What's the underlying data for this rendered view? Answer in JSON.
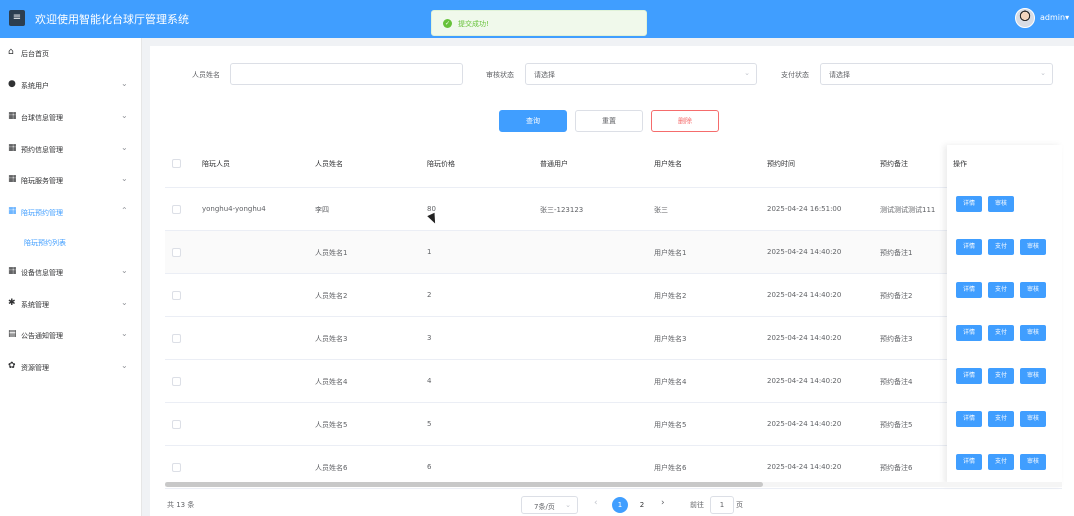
{
  "header": {
    "menu_toggle_glyph": "≡",
    "title": "欢迎使用智能化台球厅管理系统",
    "user_name": "admin▾"
  },
  "toast": {
    "icon_glyph": "✓",
    "message": "提交成功!"
  },
  "sidebar": {
    "items": [
      {
        "label": "后台首页",
        "icon": "home-icon",
        "glyph": "⌂",
        "arrow": ""
      },
      {
        "label": "系统用户",
        "icon": "user-icon",
        "glyph": "●",
        "arrow": "⌄"
      },
      {
        "label": "台球信息管理",
        "icon": "grid-icon",
        "glyph": "▦",
        "arrow": "⌄"
      },
      {
        "label": "预约信息管理",
        "icon": "grid-icon",
        "glyph": "▦",
        "arrow": "⌄"
      },
      {
        "label": "陪玩服务管理",
        "icon": "grid-icon",
        "glyph": "▦",
        "arrow": "⌄"
      },
      {
        "label": "陪玩预约管理",
        "icon": "grid-icon",
        "glyph": "▦",
        "arrow": "⌃",
        "active": true
      },
      {
        "label": "设备信息管理",
        "icon": "grid-icon",
        "glyph": "▦",
        "arrow": "⌄"
      },
      {
        "label": "系统管理",
        "icon": "gear-icon",
        "glyph": "✱",
        "arrow": "⌄"
      },
      {
        "label": "公告通知管理",
        "icon": "document-icon",
        "glyph": "▤",
        "arrow": "⌄"
      },
      {
        "label": "资源管理",
        "icon": "settings-icon",
        "glyph": "✿",
        "arrow": "⌄"
      }
    ],
    "sub_item": "陪玩预约列表"
  },
  "search": {
    "name_label": "人员姓名",
    "name_value": "",
    "review_label": "审核状态",
    "review_placeholder": "请选择",
    "pay_label": "支付状态",
    "pay_placeholder": "请选择",
    "select_arrow": "⌄"
  },
  "actions": {
    "query": "查询",
    "reset": "重置",
    "delete": "删除"
  },
  "table": {
    "columns": [
      "陪玩人员",
      "人员姓名",
      "陪玩价格",
      "普通用户",
      "用户姓名",
      "预约时间",
      "预约备注",
      "操作"
    ],
    "rows": [
      {
        "companion": "yonghu4-yonghu4",
        "name": "李四",
        "price": "80",
        "user": "张三-123123",
        "user_name": "张三",
        "time": "2025-04-24 16:51:00",
        "note": "测试测试测试111",
        "ops": [
          "详情",
          "审核"
        ]
      },
      {
        "companion": "",
        "name": "人员姓名1",
        "price": "1",
        "user": "",
        "user_name": "用户姓名1",
        "time": "2025-04-24 14:40:20",
        "note": "预约备注1",
        "ops": [
          "详情",
          "支付",
          "审核"
        ]
      },
      {
        "companion": "",
        "name": "人员姓名2",
        "price": "2",
        "user": "",
        "user_name": "用户姓名2",
        "time": "2025-04-24 14:40:20",
        "note": "预约备注2",
        "ops": [
          "详情",
          "支付",
          "审核"
        ]
      },
      {
        "companion": "",
        "name": "人员姓名3",
        "price": "3",
        "user": "",
        "user_name": "用户姓名3",
        "time": "2025-04-24 14:40:20",
        "note": "预约备注3",
        "ops": [
          "详情",
          "支付",
          "审核"
        ]
      },
      {
        "companion": "",
        "name": "人员姓名4",
        "price": "4",
        "user": "",
        "user_name": "用户姓名4",
        "time": "2025-04-24 14:40:20",
        "note": "预约备注4",
        "ops": [
          "详情",
          "支付",
          "审核"
        ]
      },
      {
        "companion": "",
        "name": "人员姓名5",
        "price": "5",
        "user": "",
        "user_name": "用户姓名5",
        "time": "2025-04-24 14:40:20",
        "note": "预约备注5",
        "ops": [
          "详情",
          "支付",
          "审核"
        ]
      },
      {
        "companion": "",
        "name": "人员姓名6",
        "price": "6",
        "user": "",
        "user_name": "用户姓名6",
        "time": "2025-04-24 14:40:20",
        "note": "预约备注6",
        "ops": [
          "详情",
          "支付",
          "审核"
        ]
      }
    ]
  },
  "pagination": {
    "total": "共 13 条",
    "page_size": "7条/页",
    "prev_glyph": "‹",
    "next_glyph": "›",
    "pages": [
      "1",
      "2"
    ],
    "current_page": "1",
    "goto_prefix": "前往",
    "goto_value": "1",
    "goto_suffix": "页"
  },
  "colors": {
    "primary": "#409eff",
    "danger": "#f56c6c",
    "success": "#67c23a"
  }
}
